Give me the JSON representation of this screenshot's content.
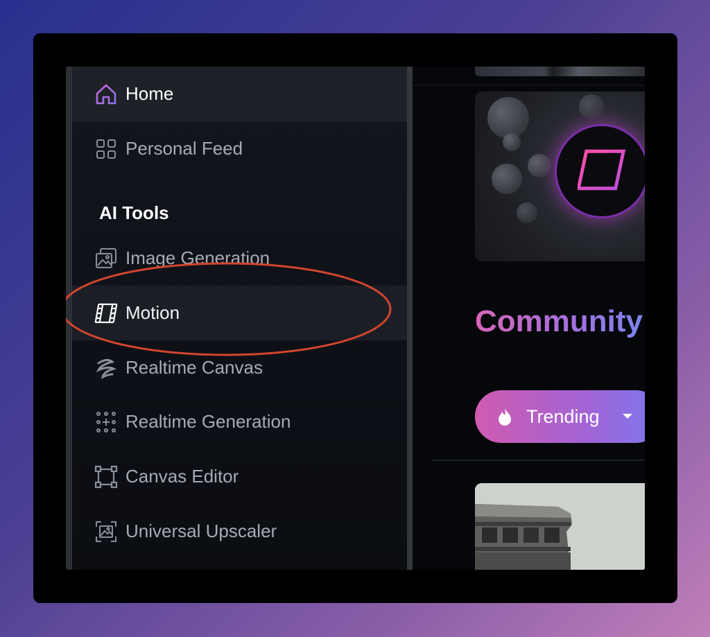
{
  "sidebar": {
    "items": [
      {
        "label": "Home",
        "icon": "home-icon"
      },
      {
        "label": "Personal Feed",
        "icon": "grid-icon"
      }
    ],
    "section_title": "AI Tools",
    "tools": [
      {
        "label": "Image Generation",
        "icon": "image-stack-icon"
      },
      {
        "label": "Motion",
        "icon": "film-icon"
      },
      {
        "label": "Realtime Canvas",
        "icon": "scribble-icon"
      },
      {
        "label": "Realtime Generation",
        "icon": "dots-plus-icon"
      },
      {
        "label": "Canvas Editor",
        "icon": "crop-frame-icon"
      },
      {
        "label": "Universal Upscaler",
        "icon": "upscale-icon"
      }
    ]
  },
  "main": {
    "feature_card_icon": "film-icon",
    "heading": "Community",
    "filter_button": {
      "label": "Trending",
      "icon": "flame-icon",
      "caret": "caret-down-icon"
    }
  },
  "annotation": {
    "highlight_color": "#d2452f",
    "target": "Motion"
  },
  "colors": {
    "accent_pink": "#d865b8",
    "accent_purple": "#7a86f0"
  }
}
